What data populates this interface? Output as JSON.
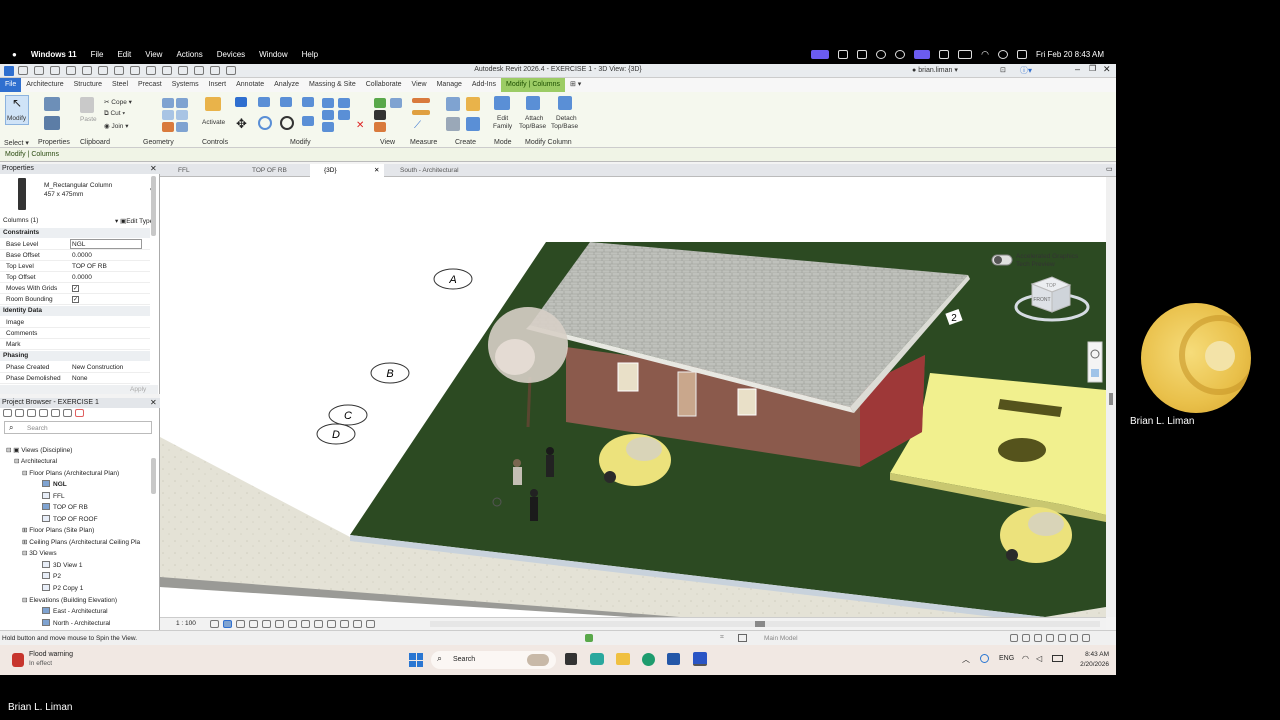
{
  "macbar": {
    "apple": "",
    "menus": [
      "Windows 11",
      "File",
      "Edit",
      "View",
      "Actions",
      "Devices",
      "Window",
      "Help"
    ],
    "clock": "Fri Feb 20  8:43 AM"
  },
  "revit": {
    "title": "Autodesk Revit 2026.4 - EXERCISE 1 - 3D View: {3D}",
    "user": "brian.liman",
    "tabs": [
      "File",
      "Architecture",
      "Structure",
      "Steel",
      "Precast",
      "Systems",
      "Insert",
      "Annotate",
      "Analyze",
      "Massing & Site",
      "Collaborate",
      "View",
      "Manage",
      "Add-Ins",
      "Modify | Columns"
    ],
    "ribbon": {
      "modify": "Modify",
      "cope": "Cope",
      "cut": "Cut",
      "join": "Join",
      "paste": "Paste",
      "activate": "Activate",
      "edit_family": [
        "Edit",
        "Family"
      ],
      "attach": [
        "Attach",
        "Top/Base"
      ],
      "detach": [
        "Detach",
        "Top/Base"
      ],
      "groups": [
        "Select",
        "Properties",
        "Clipboard",
        "Geometry",
        "Controls",
        "Modify",
        "View",
        "Measure",
        "Create",
        "Mode",
        "Modify Column"
      ]
    },
    "context_label": "Modify | Columns"
  },
  "properties": {
    "header": "Properties",
    "family": "M_Rectangular Column",
    "type": "457 x 475mm",
    "selection": "Columns (1)",
    "edit_type": "Edit Type",
    "sections": {
      "constraints": "Constraints",
      "identity": "Identity Data",
      "phasing": "Phasing"
    },
    "rows": [
      {
        "k": "Base Level",
        "v": "NGL"
      },
      {
        "k": "Base Offset",
        "v": "0.0000"
      },
      {
        "k": "Top Level",
        "v": "TOP OF RB"
      },
      {
        "k": "Top Offset",
        "v": "0.0000"
      },
      {
        "k": "Moves With Grids",
        "v": "✓"
      },
      {
        "k": "Room Bounding",
        "v": "✓"
      },
      {
        "k": "Image",
        "v": ""
      },
      {
        "k": "Comments",
        "v": ""
      },
      {
        "k": "Mark",
        "v": ""
      },
      {
        "k": "Phase Created",
        "v": "New Construction"
      },
      {
        "k": "Phase Demolished",
        "v": "None"
      }
    ],
    "apply": "Apply"
  },
  "browser": {
    "header": "Project Browser - EXERCISE 1",
    "search": "Search",
    "items": [
      "Views (Discipline)",
      "Architectural",
      "Floor Plans (Architectural Plan)",
      "NGL",
      "FFL",
      "TOP OF RB",
      "TOP OF ROOF",
      "Floor Plans (Site Plan)",
      "Ceiling Plans (Architectural Ceiling Pla",
      "3D Views",
      "3D View 1",
      "P2",
      "P2 Copy 1",
      "Elevations (Building Elevation)",
      "East - Architectural",
      "North - Architectural"
    ]
  },
  "view_tabs": [
    "FFL",
    "TOP OF RB",
    "{3D}",
    "South - Architectural"
  ],
  "viewport": {
    "grid_labels": [
      "A",
      "B",
      "C",
      "D",
      "2"
    ],
    "accel": [
      "Accelerated Graphics",
      "Tech Preview"
    ],
    "viewcube_top": "TOP",
    "viewcube_front": "FRONT"
  },
  "view_bar": {
    "scale": "1 : 100"
  },
  "status": {
    "hint": "Hold button and move mouse to Spin the View.",
    "model": "Main Model"
  },
  "taskbar": {
    "weather_title": "Flood warning",
    "weather_sub": "In effect",
    "search": "Search",
    "lang": "ENG",
    "time": "8:43 AM",
    "date": "2/20/2026"
  },
  "participant": "Brian L. Liman",
  "self_name": "Brian L. Liman"
}
